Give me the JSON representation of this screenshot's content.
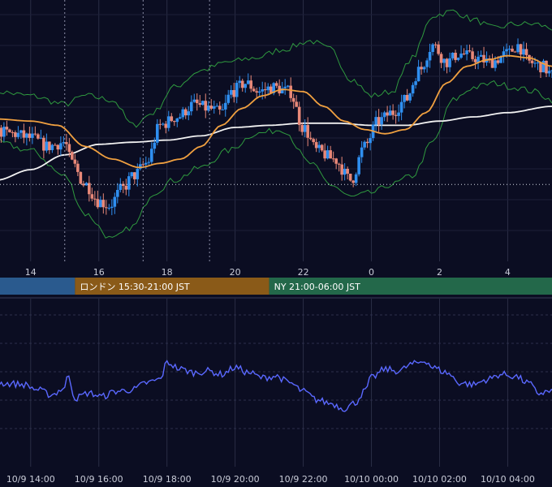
{
  "colors": {
    "background": "#0b0d22",
    "grid": "#2a2d45",
    "candle_up": "#2f8ff0",
    "candle_down": "#e88878",
    "ma_short": "#f0a040",
    "ma_long": "#f2f2f2",
    "bollinger": "#2f9a3f",
    "oscillator": "#5a68ff",
    "session_tokyo": "#2a5a8e",
    "session_london": "#8a5a18",
    "session_ny": "#23684a"
  },
  "sessions": [
    {
      "label": "",
      "color_key": "session_tokyo",
      "start": 13.0,
      "end": 15.3
    },
    {
      "label": "ロンドン 15:30-21:00 JST",
      "color_key": "session_london",
      "start": 15.3,
      "end": 21.0
    },
    {
      "label": "NY 21:00-06:00 JST",
      "color_key": "session_ny",
      "start": 21.0,
      "end": 30.0
    }
  ],
  "chart_data": [
    {
      "type": "candlestick",
      "title": "",
      "x_unit": "hours (10/9 JST, continuing into 10/10)",
      "xlim": [
        13.1,
        29.3
      ],
      "ylim": [
        0,
        100
      ],
      "x_tick_labels": [
        {
          "x": 14,
          "label": "14"
        },
        {
          "x": 16,
          "label": "16"
        },
        {
          "x": 18,
          "label": "18"
        },
        {
          "x": 20,
          "label": "20"
        },
        {
          "x": 22,
          "label": "22"
        },
        {
          "x": 24,
          "label": "0"
        },
        {
          "x": 26,
          "label": "2"
        },
        {
          "x": 28,
          "label": "4"
        }
      ],
      "session_open_markers_x": [
        15.0,
        17.3,
        19.25
      ],
      "reference_level": 28,
      "price_anchors": [
        [
          13.0,
          53
        ],
        [
          13.5,
          52
        ],
        [
          14.0,
          50
        ],
        [
          14.5,
          46
        ],
        [
          15.0,
          48
        ],
        [
          15.2,
          38
        ],
        [
          15.6,
          28
        ],
        [
          16.0,
          20
        ],
        [
          16.3,
          18
        ],
        [
          16.7,
          26
        ],
        [
          17.0,
          32
        ],
        [
          17.4,
          38
        ],
        [
          17.8,
          56
        ],
        [
          18.3,
          60
        ],
        [
          18.8,
          66
        ],
        [
          19.2,
          64
        ],
        [
          19.6,
          62
        ],
        [
          19.9,
          72
        ],
        [
          20.3,
          76
        ],
        [
          20.7,
          72
        ],
        [
          21.1,
          74
        ],
        [
          21.6,
          72
        ],
        [
          22.0,
          55
        ],
        [
          22.4,
          44
        ],
        [
          22.9,
          40
        ],
        [
          23.4,
          30
        ],
        [
          23.8,
          46
        ],
        [
          24.2,
          58
        ],
        [
          24.6,
          62
        ],
        [
          25.0,
          68
        ],
        [
          25.4,
          82
        ],
        [
          25.8,
          94
        ],
        [
          26.2,
          86
        ],
        [
          26.6,
          90
        ],
        [
          27.0,
          88
        ],
        [
          27.5,
          86
        ],
        [
          28.0,
          90
        ],
        [
          28.3,
          94
        ],
        [
          28.6,
          86
        ],
        [
          29.0,
          84
        ],
        [
          29.3,
          80
        ]
      ],
      "ma_short_anchors": [
        [
          13.0,
          59
        ],
        [
          14.0,
          58
        ],
        [
          14.8,
          56
        ],
        [
          15.6,
          46
        ],
        [
          16.4,
          40
        ],
        [
          17.2,
          36
        ],
        [
          17.8,
          38
        ],
        [
          18.4,
          40
        ],
        [
          19.0,
          46
        ],
        [
          19.6,
          56
        ],
        [
          20.2,
          64
        ],
        [
          20.8,
          70
        ],
        [
          21.4,
          73
        ],
        [
          22.0,
          72
        ],
        [
          22.6,
          65
        ],
        [
          23.2,
          58
        ],
        [
          23.8,
          54
        ],
        [
          24.4,
          52
        ],
        [
          25.0,
          54
        ],
        [
          25.6,
          62
        ],
        [
          26.2,
          76
        ],
        [
          26.8,
          84
        ],
        [
          27.4,
          87
        ],
        [
          28.0,
          89
        ],
        [
          28.6,
          88
        ],
        [
          29.3,
          84
        ]
      ],
      "ma_long_anchors": [
        [
          13.0,
          30
        ],
        [
          14.0,
          35
        ],
        [
          15.0,
          42
        ],
        [
          16.0,
          47
        ],
        [
          17.0,
          48
        ],
        [
          18.0,
          49
        ],
        [
          19.0,
          51
        ],
        [
          20.0,
          55
        ],
        [
          21.0,
          56
        ],
        [
          22.0,
          57
        ],
        [
          23.0,
          57
        ],
        [
          24.0,
          56
        ],
        [
          25.0,
          56
        ],
        [
          26.0,
          58
        ],
        [
          27.0,
          60
        ],
        [
          28.0,
          62
        ],
        [
          29.3,
          65
        ]
      ],
      "bollinger_upper_anchors": [
        [
          13.0,
          72
        ],
        [
          14.0,
          70
        ],
        [
          15.0,
          66
        ],
        [
          15.6,
          70
        ],
        [
          16.4,
          68
        ],
        [
          17.0,
          56
        ],
        [
          17.6,
          62
        ],
        [
          18.2,
          74
        ],
        [
          19.0,
          82
        ],
        [
          19.8,
          86
        ],
        [
          20.6,
          88
        ],
        [
          21.4,
          92
        ],
        [
          22.2,
          96
        ],
        [
          22.8,
          92
        ],
        [
          23.4,
          78
        ],
        [
          24.0,
          70
        ],
        [
          24.6,
          72
        ],
        [
          25.2,
          88
        ],
        [
          25.8,
          108
        ],
        [
          26.4,
          110
        ],
        [
          27.0,
          106
        ],
        [
          27.6,
          102
        ],
        [
          28.2,
          104
        ],
        [
          28.8,
          104
        ],
        [
          29.3,
          102
        ]
      ],
      "bollinger_lower_anchors": [
        [
          13.0,
          48
        ],
        [
          14.0,
          44
        ],
        [
          15.0,
          32
        ],
        [
          15.6,
          14
        ],
        [
          16.4,
          2
        ],
        [
          17.0,
          8
        ],
        [
          17.6,
          24
        ],
        [
          18.2,
          30
        ],
        [
          19.0,
          36
        ],
        [
          19.8,
          44
        ],
        [
          20.6,
          52
        ],
        [
          21.4,
          54
        ],
        [
          22.2,
          38
        ],
        [
          22.8,
          28
        ],
        [
          23.4,
          22
        ],
        [
          24.0,
          24
        ],
        [
          24.6,
          28
        ],
        [
          25.2,
          32
        ],
        [
          25.8,
          48
        ],
        [
          26.4,
          68
        ],
        [
          27.0,
          74
        ],
        [
          27.6,
          76
        ],
        [
          28.2,
          74
        ],
        [
          28.8,
          72
        ],
        [
          29.3,
          68
        ]
      ]
    },
    {
      "type": "line",
      "title": "",
      "x_unit": "hours (10/9 JST, continuing into 10/10)",
      "xlim": [
        13.1,
        29.3
      ],
      "ylim": [
        0,
        100
      ],
      "x_tick_labels": [
        {
          "x": 14,
          "label": "10/9 14:00"
        },
        {
          "x": 16,
          "label": "10/9 16:00"
        },
        {
          "x": 18,
          "label": "10/9 18:00"
        },
        {
          "x": 20,
          "label": "10/9 20:00"
        },
        {
          "x": 22,
          "label": "10/9 22:00"
        },
        {
          "x": 24,
          "label": "10/10 00:00"
        },
        {
          "x": 26,
          "label": "10/10 02:00"
        },
        {
          "x": 28,
          "label": "10/10 04:00"
        }
      ],
      "oscillator_anchors": [
        [
          13.0,
          46
        ],
        [
          13.4,
          45
        ],
        [
          13.8,
          44
        ],
        [
          14.2,
          38
        ],
        [
          14.6,
          32
        ],
        [
          15.0,
          40
        ],
        [
          15.1,
          56
        ],
        [
          15.3,
          28
        ],
        [
          15.7,
          34
        ],
        [
          16.1,
          30
        ],
        [
          16.5,
          36
        ],
        [
          17.0,
          38
        ],
        [
          17.4,
          46
        ],
        [
          17.8,
          50
        ],
        [
          18.0,
          70
        ],
        [
          18.4,
          62
        ],
        [
          18.8,
          58
        ],
        [
          19.2,
          60
        ],
        [
          19.6,
          56
        ],
        [
          20.0,
          64
        ],
        [
          20.4,
          58
        ],
        [
          20.8,
          52
        ],
        [
          21.2,
          54
        ],
        [
          21.6,
          46
        ],
        [
          22.0,
          36
        ],
        [
          22.4,
          26
        ],
        [
          22.8,
          22
        ],
        [
          23.2,
          16
        ],
        [
          23.5,
          22
        ],
        [
          23.8,
          36
        ],
        [
          24.0,
          52
        ],
        [
          24.4,
          62
        ],
        [
          24.8,
          60
        ],
        [
          25.2,
          68
        ],
        [
          25.6,
          72
        ],
        [
          25.8,
          64
        ],
        [
          26.2,
          58
        ],
        [
          26.6,
          46
        ],
        [
          27.0,
          44
        ],
        [
          27.4,
          50
        ],
        [
          27.8,
          56
        ],
        [
          28.2,
          54
        ],
        [
          28.6,
          46
        ],
        [
          28.9,
          34
        ],
        [
          29.3,
          36
        ]
      ]
    }
  ]
}
